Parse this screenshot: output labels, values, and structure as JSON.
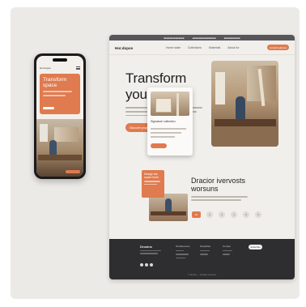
{
  "colors": {
    "accent": "#e07a4f",
    "dark": "#2e2e30",
    "background": "#eceae6"
  },
  "phone": {
    "logo": "Hor.dopos",
    "hero_title": "Transform space",
    "menu_icon": "hamburger-icon"
  },
  "desktop": {
    "topbar": [
      "■■■■■■■■■■■■■■",
      "■■■■■■■■■■■■■■■■",
      "■■■■■■■■■■■"
    ],
    "logo": "Hor.dopos",
    "nav_links": [
      "Home state",
      "Collections",
      "Materials",
      "About for"
    ],
    "nav_button": "Contact planner",
    "hero": {
      "title": "Transform your space",
      "cta": "Discover projects"
    },
    "overlay_card": {
      "heading": "Signature collection"
    },
    "section": {
      "card_title": "Design the space build",
      "title": "Dracior ivervosts worsuns",
      "pager": [
        "01",
        "2",
        "3",
        "4",
        "5",
        "6"
      ]
    },
    "footer": {
      "logo": "Drosins",
      "col1": "Teroferences",
      "col2": "Sonplities",
      "col3": "Compa",
      "button": "Subscribe",
      "copyright": "© Drosins — all rights reserved"
    }
  }
}
